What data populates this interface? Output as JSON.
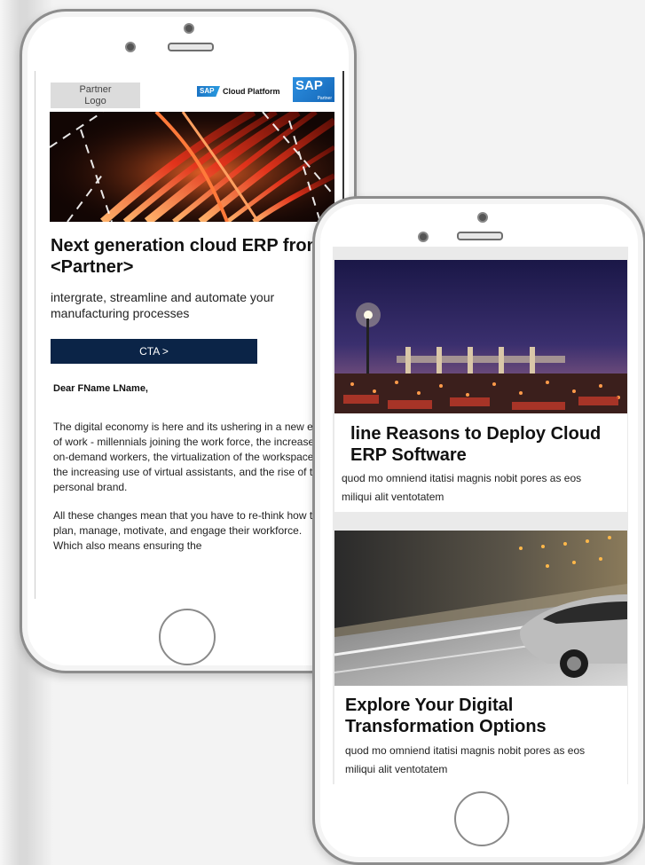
{
  "email": {
    "partner_logo": "Partner\nLogo",
    "cloud_platform_mark": "SAP",
    "cloud_platform_text": "Cloud Platform",
    "sap_partner_big": "SAP",
    "sap_partner_small": "Partner",
    "headline": "Next generation cloud ERP from <Partner>",
    "subhead": "intergrate, streamline and automate your manufacturing processes",
    "cta_label": "CTA >",
    "greeting": "Dear FName LName,",
    "paragraph_1": "The digital economy is here and its ushering in a new era of work - millennials joining the work force, the increase in on-demand workers, the virtualization of the workspace, the increasing use of virtual assistants, and the rise of the personal brand.",
    "paragraph_2": "All these changes mean that you have to re-think how they plan, manage, motivate, and engage their workforce. Which also means ensuring the"
  },
  "article_list": {
    "cards": [
      {
        "title": "line Reasons to Deploy Cloud ERP Software",
        "text": "quod mo omniend itatisi magnis nobit pores as eos miliqui alit ventotatem",
        "image": "night-harbor-photo"
      },
      {
        "title": "Explore Your Digital Transformation Options",
        "text": "quod mo omniend itatisi magnis nobit pores as eos miliqui alit ventotatem",
        "image": "car-in-tunnel-photo"
      }
    ]
  },
  "colors": {
    "cta_background": "#0b2447",
    "sap_blue": "#1b74c4"
  }
}
